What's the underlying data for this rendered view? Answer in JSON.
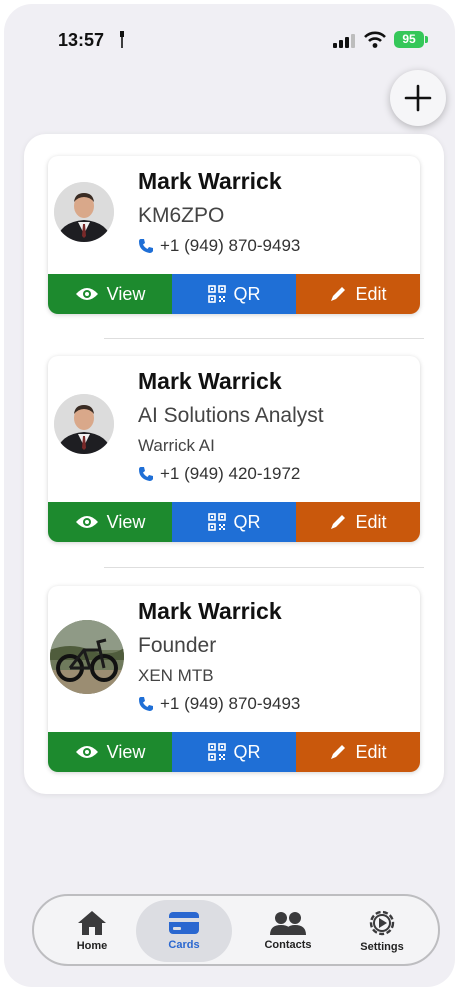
{
  "status_bar": {
    "time": "13:57",
    "battery": "95"
  },
  "cards": [
    {
      "name": "Mark Warrick",
      "line1": "KM6ZPO",
      "phone": "+1 (949) 870-9493",
      "avatar": "business-portrait"
    },
    {
      "name": "Mark Warrick",
      "line1": "AI Solutions Analyst",
      "line2": "Warrick AI",
      "phone": "+1 (949) 420-1972",
      "avatar": "business-portrait"
    },
    {
      "name": "Mark Warrick",
      "line1": "Founder",
      "line2": "XEN MTB",
      "phone": "+1 (949) 870-9493",
      "avatar": "mountain-bike-photo"
    }
  ],
  "actions": {
    "view": "View",
    "qr": "QR",
    "edit": "Edit"
  },
  "tabs": [
    {
      "label": "Home",
      "icon": "house-icon"
    },
    {
      "label": "Cards",
      "icon": "card-icon"
    },
    {
      "label": "Contacts",
      "icon": "people-icon"
    },
    {
      "label": "Settings",
      "icon": "gear-icon"
    }
  ],
  "colors": {
    "view": "#1d8a2e",
    "qr": "#1f6fd6",
    "edit": "#c9580c",
    "active_tab": "#2a67d0",
    "battery": "#35c759"
  }
}
